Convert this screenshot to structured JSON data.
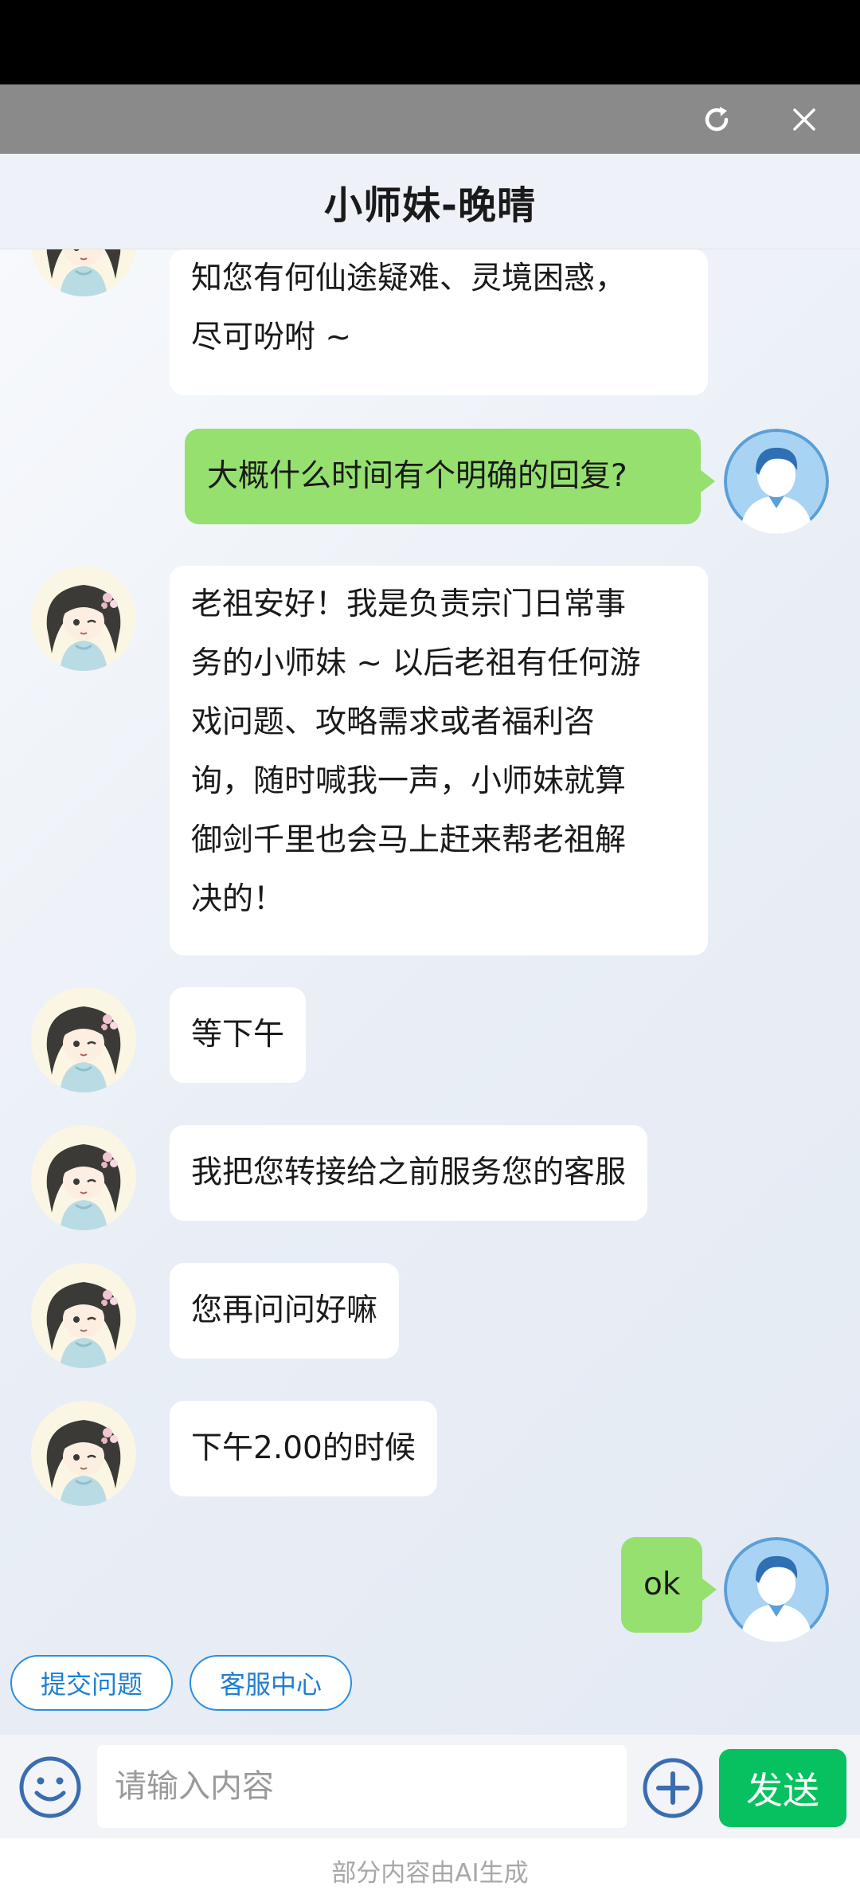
{
  "header": {
    "title": "小师妹-晚晴"
  },
  "window_controls": {
    "refresh_icon": "refresh-icon",
    "close_icon": "close-icon"
  },
  "messages": [
    {
      "side": "left",
      "lines": [
        "知您有何仙途疑难、灵境困惑，",
        "尽可吩咐 ~"
      ]
    },
    {
      "side": "right",
      "text": "大概什么时间有个明确的回复?"
    },
    {
      "side": "left",
      "lines": [
        "老祖安好！我是负责宗门日常事",
        "务的小师妹 ~ 以后老祖有任何游",
        "戏问题、攻略需求或者福利咨",
        "询，随时喊我一声，小师妹就算",
        "御剑千里也会马上赶来帮老祖解",
        "决的！"
      ]
    },
    {
      "side": "left",
      "text": "等下午"
    },
    {
      "side": "left",
      "text": "我把您转接给之前服务您的客服"
    },
    {
      "side": "left",
      "text": "您再问问好嘛"
    },
    {
      "side": "left",
      "text": "下午2.00的时候"
    },
    {
      "side": "right",
      "text": "ok"
    }
  ],
  "quick_actions": [
    "提交问题",
    "客服中心"
  ],
  "composer": {
    "placeholder": "请输入内容",
    "send_label": "发送"
  },
  "footer": {
    "notice": "部分内容由AI生成"
  },
  "colors": {
    "accent_green": "#07c160",
    "user_bubble": "#95e06e",
    "link_blue": "#1f7fd1"
  }
}
